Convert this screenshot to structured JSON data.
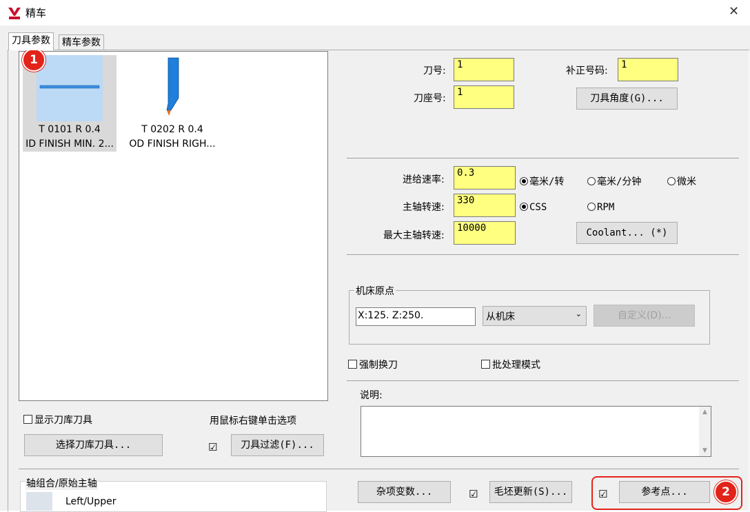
{
  "window": {
    "title": "精车",
    "close": "✕"
  },
  "tabs": [
    {
      "label": "刀具参数",
      "active": true
    },
    {
      "label": "精车参数",
      "active": false
    }
  ],
  "tools": [
    {
      "line1": "T 0101 R 0.4",
      "line2": "ID FINISH MIN. 2...",
      "selected": true
    },
    {
      "line1": "T 0202 R 0.4",
      "line2": "OD FINISH RIGH...",
      "selected": false
    }
  ],
  "tool_fields": {
    "tool_number_label": "刀号:",
    "tool_number": "1",
    "offset_label": "补正号码:",
    "offset": "1",
    "station_label": "刀座号:",
    "station": "1",
    "tool_angle_button": "刀具角度(G)..."
  },
  "feeds": {
    "feed_rate_label": "进给速率:",
    "feed_rate": "0.3",
    "spindle_speed_label": "主轴转速:",
    "spindle_speed": "330",
    "max_spindle_label": "最大主轴转速:",
    "max_spindle": "10000",
    "unit_mm_per_rev": "毫米/转",
    "unit_mm_per_min": "毫米/分钟",
    "unit_micron": "微米",
    "css": "CSS",
    "rpm": "RPM",
    "coolant_button": "Coolant... (*)"
  },
  "machine_origin": {
    "group_label": "机床原点",
    "value": "X:125.  Z:250.",
    "select_value": "从机床",
    "define_button": "自定义(D)..."
  },
  "options": {
    "force_tool_change": "强制换刀",
    "batch_mode": "批处理模式",
    "show_library": "显示刀库刀具",
    "right_click_hint": "用鼠标右键单击选项",
    "select_library_button": "选择刀库刀具...",
    "tool_filter_button": "刀具过滤(F)...",
    "filter_check": "☑"
  },
  "notes": {
    "label": "说明:"
  },
  "axis": {
    "group_label": "轴组合/原始主轴",
    "value": "Left/Upper"
  },
  "bottom_buttons": {
    "misc_values": "杂项变数...",
    "stock_update": "毛坯更新(S)...",
    "stock_check": "☑",
    "ref_point": "参考点...",
    "ref_check": "☑"
  },
  "badges": {
    "one": "1",
    "two": "2"
  },
  "colors": {
    "field_yellow": "#ffff80",
    "selection_blue": "#cce4f7",
    "badge_red": "#e2231a",
    "tool_blue": "#1e7fdc"
  }
}
